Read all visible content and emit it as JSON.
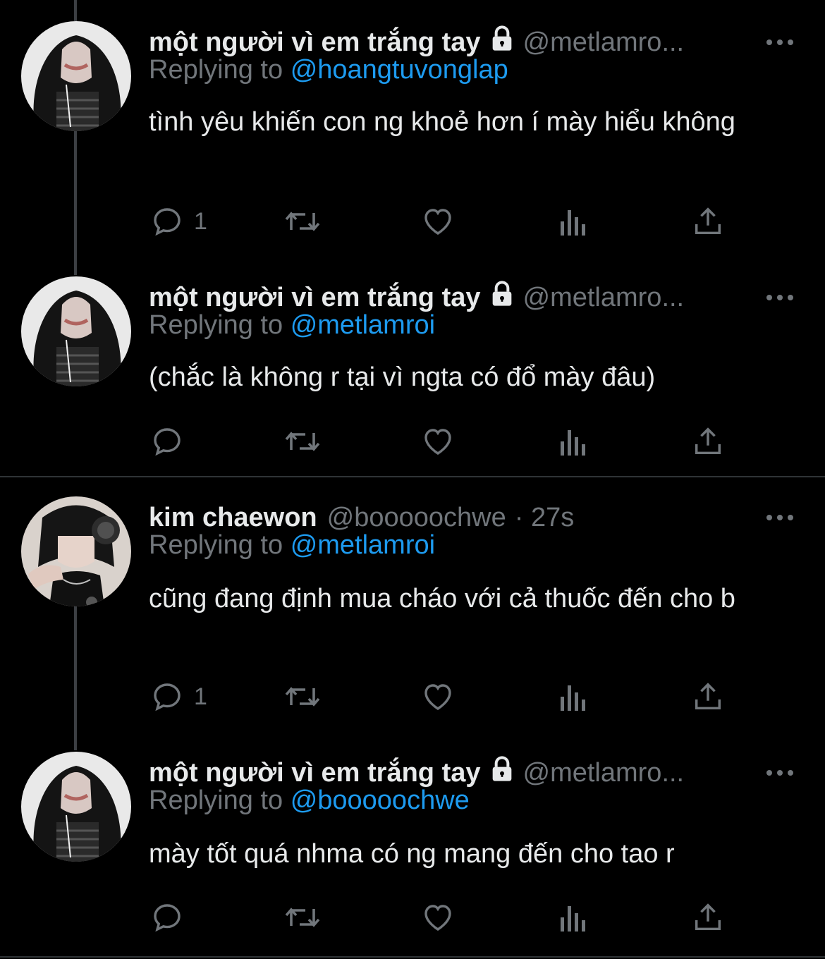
{
  "tweets": [
    {
      "name": "một người vì em trắng tay",
      "handle": "@metlamro...",
      "time": "",
      "replying_label": "Replying to",
      "replying_to": "@hoangtuvonglap",
      "text": "tình yêu khiến con ng khoẻ hơn í mày hiểu không",
      "reply_count": "1"
    },
    {
      "name": "một người vì em trắng tay",
      "handle": "@metlamro...",
      "time": "",
      "replying_label": "Replying to",
      "replying_to": "@metlamroi",
      "text": "(chắc là không r tại vì ngta có đổ mày đâu)",
      "reply_count": ""
    },
    {
      "name": "kim chaewon",
      "handle": "@booooochwe",
      "time": "· 27s",
      "replying_label": "Replying to",
      "replying_to": "@metlamroi",
      "text": "cũng đang định mua cháo với cả thuốc đến cho b",
      "reply_count": "1"
    },
    {
      "name": "một người vì em trắng tay",
      "handle": "@metlamro...",
      "time": "",
      "replying_label": "Replying to",
      "replying_to": "@booooochwe",
      "text": "mày tốt quá nhma có ng mang đến cho tao r",
      "reply_count": ""
    }
  ],
  "icons": {
    "lock": "lock-icon",
    "more": "more-icon",
    "reply": "reply-icon",
    "retweet": "retweet-icon",
    "like": "like-icon",
    "views": "views-icon",
    "share": "share-icon"
  },
  "colors": {
    "background": "#000000",
    "text": "#e7e9ea",
    "secondary": "#71767b",
    "link": "#1d9bf0",
    "thread_line": "#3c3f43",
    "separator": "#2f3336"
  }
}
